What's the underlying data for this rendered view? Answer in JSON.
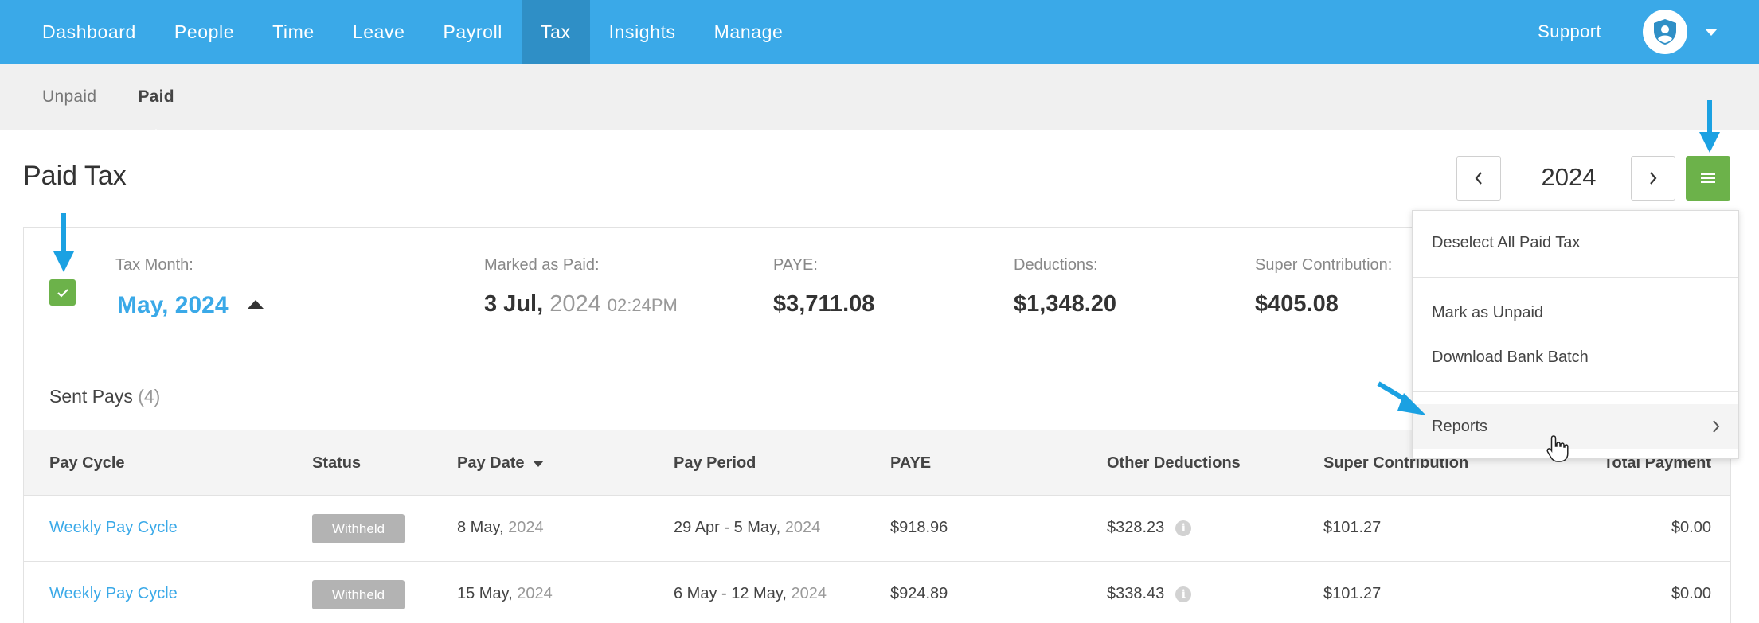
{
  "nav": {
    "items": [
      "Dashboard",
      "People",
      "Time",
      "Leave",
      "Payroll",
      "Tax",
      "Insights",
      "Manage"
    ],
    "active": "Tax",
    "support": "Support"
  },
  "subnav": {
    "tabs": [
      "Unpaid",
      "Paid"
    ],
    "active": "Paid"
  },
  "page": {
    "title": "Paid Tax"
  },
  "year_control": {
    "year": "2024"
  },
  "summary": {
    "tax_month_label": "Tax Month:",
    "tax_month_value": "May, 2024",
    "marked_paid_label": "Marked as Paid:",
    "marked_paid_day": "3 Jul,",
    "marked_paid_year": "2024",
    "marked_paid_time": "02:24PM",
    "paye_label": "PAYE:",
    "paye_value": "$3,711.08",
    "deductions_label": "Deductions:",
    "deductions_value": "$1,348.20",
    "super_label": "Super Contribution:",
    "super_value": "$405.08",
    "checkbox_checked": true
  },
  "sent_pays": {
    "label": "Sent Pays",
    "count": "(4)"
  },
  "table": {
    "headers": {
      "pay_cycle": "Pay Cycle",
      "status": "Status",
      "pay_date": "Pay Date",
      "pay_period": "Pay Period",
      "paye": "PAYE",
      "other_deductions": "Other Deductions",
      "super_contribution": "Super Contribution",
      "total_payment": "Total Payment"
    },
    "rows": [
      {
        "pay_cycle": "Weekly Pay Cycle",
        "status": "Withheld",
        "pay_date_day": "8 May,",
        "pay_date_year": "2024",
        "pay_period_range": "29 Apr - 5 May,",
        "pay_period_year": "2024",
        "paye": "$918.96",
        "other_deductions": "$328.23",
        "super_contribution": "$101.27",
        "total_payment": "$0.00"
      },
      {
        "pay_cycle": "Weekly Pay Cycle",
        "status": "Withheld",
        "pay_date_day": "15 May,",
        "pay_date_year": "2024",
        "pay_period_range": "6 May - 12 May,",
        "pay_period_year": "2024",
        "paye": "$924.89",
        "other_deductions": "$338.43",
        "super_contribution": "$101.27",
        "total_payment": "$0.00"
      }
    ]
  },
  "dropdown": {
    "items": [
      "Deselect All Paid Tax",
      "Mark as Unpaid",
      "Download Bank Batch",
      "Reports"
    ]
  },
  "colors": {
    "nav_bg": "#3aa9e8",
    "nav_active": "#2f8fc6",
    "accent_green": "#6cb24a",
    "link_blue": "#3aa9e8",
    "annotation_arrow": "#1ba1e2"
  },
  "icons": [
    "user-shield-icon",
    "chevron-left-icon",
    "chevron-right-icon",
    "hamburger-menu-icon",
    "checkmark-icon",
    "info-icon",
    "pointer-cursor-icon"
  ]
}
